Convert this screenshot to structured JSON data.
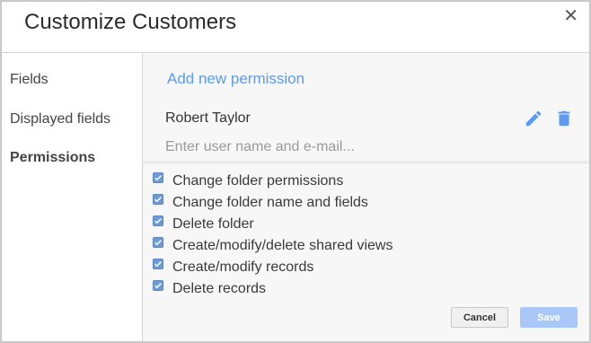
{
  "dialog": {
    "title": "Customize Customers",
    "close_icon": "close-icon"
  },
  "sidebar": {
    "items": [
      {
        "label": "Fields",
        "active": false
      },
      {
        "label": "Displayed fields",
        "active": false
      },
      {
        "label": "Permissions",
        "active": true
      }
    ]
  },
  "main": {
    "add_permission_label": "Add new permission",
    "user": {
      "name": "Robert Taylor",
      "edit_icon": "pencil-icon",
      "delete_icon": "trash-icon"
    },
    "user_input": {
      "placeholder": "Enter user name and e-mail...",
      "value": ""
    },
    "permissions": [
      {
        "label": "Change folder permissions",
        "checked": true
      },
      {
        "label": "Change folder name and fields",
        "checked": true
      },
      {
        "label": "Delete folder",
        "checked": true
      },
      {
        "label": "Create/modify/delete shared views",
        "checked": true
      },
      {
        "label": "Create/modify records",
        "checked": true
      },
      {
        "label": "Delete records",
        "checked": true
      }
    ],
    "buttons": {
      "cancel_label": "Cancel",
      "save_label": "Save"
    }
  },
  "colors": {
    "accent": "#5b9bf2",
    "icon": "#5b9bf2",
    "checkbox": "#6e9ad8",
    "save_disabled": "#a9c8f7"
  }
}
